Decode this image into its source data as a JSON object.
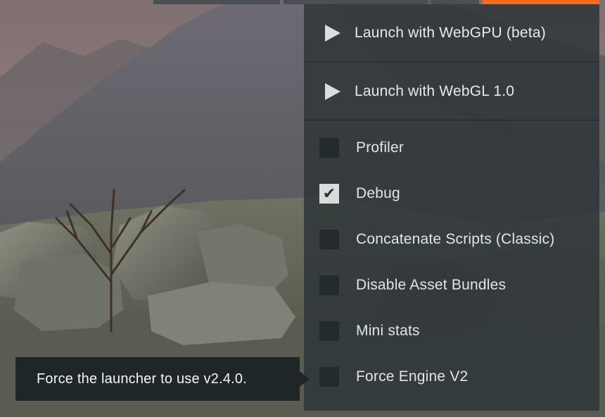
{
  "launch_menu": {
    "items": [
      {
        "label": "Launch with WebGPU (beta)",
        "icon": "play-icon"
      },
      {
        "label": "Launch with WebGL 1.0",
        "icon": "play-icon"
      }
    ],
    "options": [
      {
        "label": "Profiler",
        "checked": false
      },
      {
        "label": "Debug",
        "checked": true
      },
      {
        "label": "Concatenate Scripts (Classic)",
        "checked": false
      },
      {
        "label": "Disable Asset Bundles",
        "checked": false
      },
      {
        "label": "Mini stats",
        "checked": false
      },
      {
        "label": "Force Engine V2",
        "checked": false
      }
    ]
  },
  "tooltip": {
    "text": "Force the launcher to use v2.4.0."
  },
  "colors": {
    "accent": "#fe6a1b",
    "menu_bg": "#2d3538",
    "tooltip_bg": "#1f2628"
  }
}
